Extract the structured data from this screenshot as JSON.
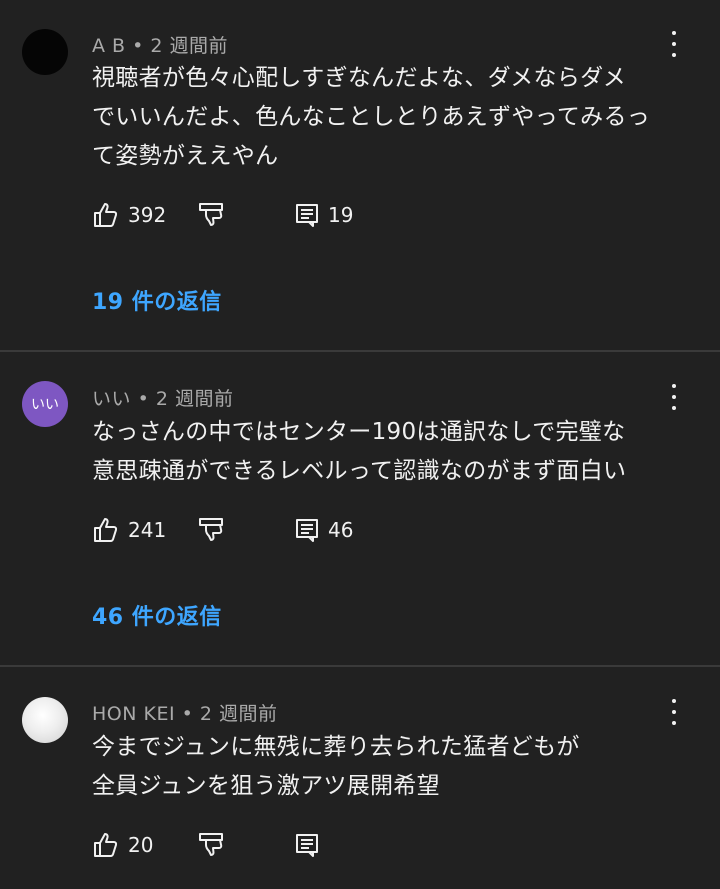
{
  "comments": [
    {
      "author": "A B",
      "time": "2 週間前",
      "text": "視聴者が色々心配しすぎなんだよな、ダメならダメ\nでいいんだよ、色んなことしとりあえずやってみるっ\nて姿勢がええやん",
      "likes": "392",
      "reply_count": "19",
      "replies_link": "19 件の返信",
      "avatar_text": ""
    },
    {
      "author": "いい",
      "time": "2 週間前",
      "text": "なっさんの中ではセンター190は通訳なしで完璧な\n意思疎通ができるレベルって認識なのがまず面白い",
      "likes": "241",
      "reply_count": "46",
      "replies_link": "46 件の返信",
      "avatar_text": "いい"
    },
    {
      "author": "HON KEI",
      "time": "2 週間前",
      "text": "今までジュンに無残に葬り去られた猛者どもが\n全員ジュンを狙う激アツ展開希望",
      "likes": "20",
      "reply_count": "",
      "replies_link": "",
      "avatar_text": ""
    }
  ],
  "separator": "•",
  "colors": {
    "background": "#212121",
    "text": "#f1f1f1",
    "meta": "#aaaaaa",
    "link": "#3ea6ff",
    "avatar_purple": "#7e57c2"
  },
  "icons": {
    "like": "thumbs-up-icon",
    "dislike": "thumbs-down-icon",
    "reply": "comment-icon",
    "more": "more-vertical-icon"
  }
}
